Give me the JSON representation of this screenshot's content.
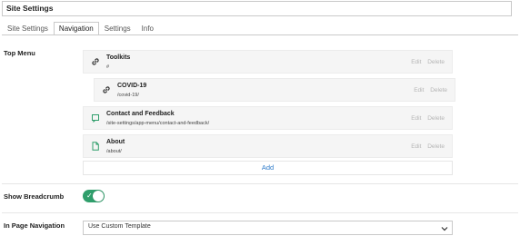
{
  "page": {
    "title": "Site Settings"
  },
  "tabs": [
    {
      "label": "Site Settings",
      "active": false
    },
    {
      "label": "Navigation",
      "active": true
    },
    {
      "label": "Settings",
      "active": false
    },
    {
      "label": "Info",
      "active": false
    }
  ],
  "top_menu": {
    "label": "Top Menu",
    "items": [
      {
        "title": "Toolkits",
        "url": "#",
        "icon": "link-icon",
        "indented": false
      },
      {
        "title": "COVID-19",
        "url": "/covid-19/",
        "icon": "link-icon",
        "indented": true
      },
      {
        "title": "Contact and Feedback",
        "url": "/site-settings/app-menu/contact-and-feedback/",
        "icon": "page-app-icon",
        "indented": false
      },
      {
        "title": "About",
        "url": "/about/",
        "icon": "page-icon",
        "indented": false
      }
    ],
    "edit_label": "Edit",
    "delete_label": "Delete",
    "add_label": "Add"
  },
  "breadcrumb": {
    "label": "Show Breadcrumb",
    "enabled": true
  },
  "in_page_nav": {
    "label": "In Page Navigation",
    "selected": "Use Custom Template"
  },
  "colors": {
    "accent": "#2f9e6b",
    "link": "#2d7ac9",
    "item_bg": "#f5f5f5"
  }
}
